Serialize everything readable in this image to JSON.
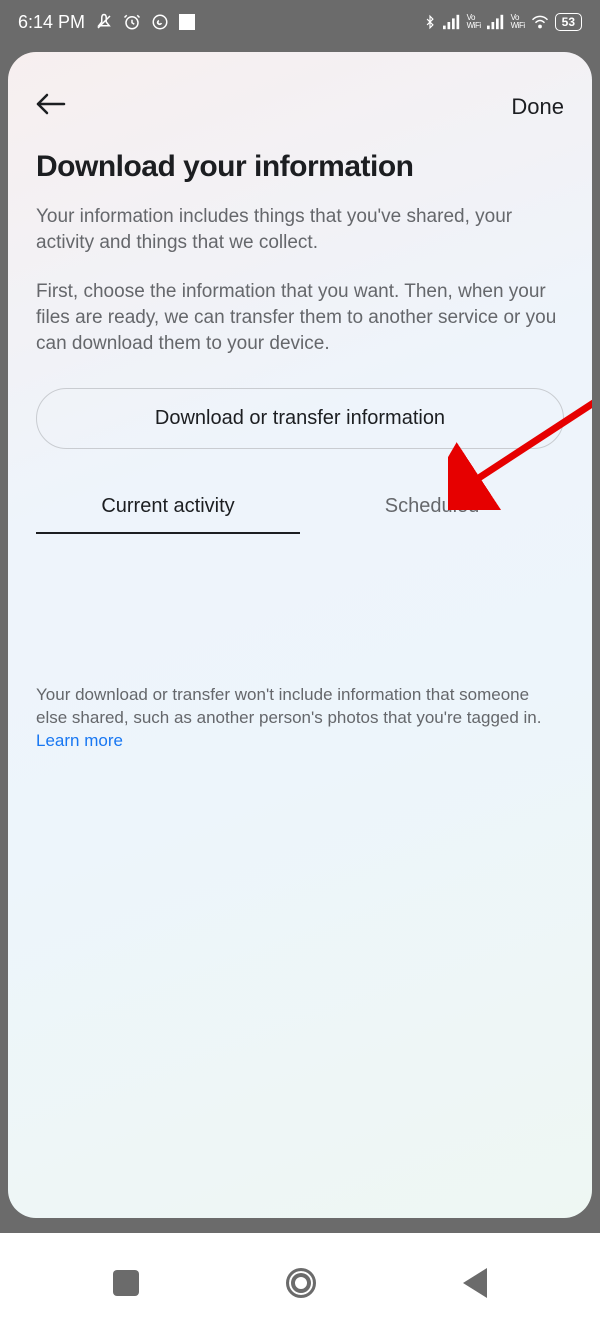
{
  "status": {
    "time": "6:14 PM",
    "battery": "53"
  },
  "header": {
    "done": "Done"
  },
  "page": {
    "title": "Download your information",
    "para1": "Your information includes things that you've shared, your activity and things that we collect.",
    "para2": "First, choose the information that you want. Then, when your files are ready, we can transfer them to another service or you can download them to your device.",
    "button": "Download or transfer information"
  },
  "tabs": {
    "current": "Current activity",
    "scheduled": "Scheduled"
  },
  "disclaimer": {
    "text": "Your download or transfer won't include information that someone else shared, such as another person's photos that you're tagged in. ",
    "link": "Learn more"
  }
}
